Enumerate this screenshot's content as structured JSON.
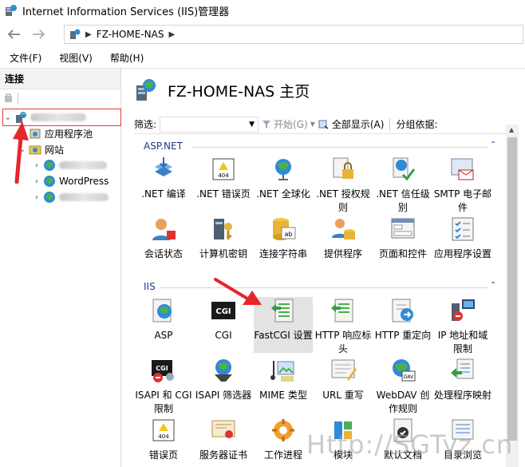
{
  "window": {
    "title": "Internet Information Services (IIS)管理器"
  },
  "address": {
    "path": [
      "FZ-HOME-NAS"
    ]
  },
  "menu": {
    "items": [
      "文件(F)",
      "视图(V)",
      "帮助(H)"
    ]
  },
  "left": {
    "header": "连接",
    "tree": {
      "server": "",
      "app_pools": "应用程序池",
      "sites": "网站",
      "site2": "WordPress"
    }
  },
  "main": {
    "title": "FZ-HOME-NAS 主页",
    "filter": {
      "label": "筛选:",
      "start": "开始(G)",
      "show_all": "全部显示(A)",
      "group_by": "分组依据:"
    },
    "sections": [
      {
        "name": "ASP.NET",
        "items": [
          ".NET 编译",
          ".NET 错误页",
          ".NET 全球化",
          ".NET 授权规则",
          ".NET 信任级别",
          "SMTP 电子邮件",
          "会话状态",
          "计算机密钥",
          "连接字符串",
          "提供程序",
          "页面和控件",
          "应用程序设置"
        ]
      },
      {
        "name": "IIS",
        "items": [
          "ASP",
          "CGI",
          "FastCGI 设置",
          "HTTP 响应标头",
          "HTTP 重定向",
          "IP 地址和域限制",
          "ISAPI 和 CGI 限制",
          "ISAPI 筛选器",
          "MIME 类型",
          "URL 重写",
          "WebDAV 创作规则",
          "处理程序映射",
          "错误页",
          "服务器证书",
          "工作进程",
          "模块",
          "默认文档",
          "目录浏览"
        ]
      }
    ]
  },
  "watermark": "Http://SGTyz.cn"
}
